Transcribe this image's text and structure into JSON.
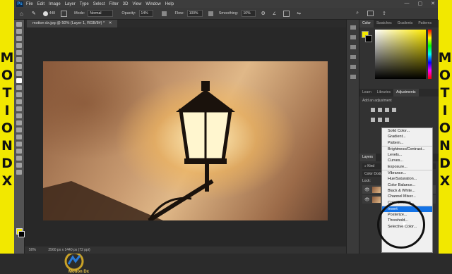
{
  "brand": {
    "letters": [
      "M",
      "O",
      "T",
      "I",
      "O",
      "N",
      "D",
      "X"
    ]
  },
  "menubar": {
    "logo": "Ps",
    "items": [
      "File",
      "Edit",
      "Image",
      "Layer",
      "Type",
      "Select",
      "Filter",
      "3D",
      "View",
      "Window",
      "Help"
    ]
  },
  "options": {
    "mode_label": "Mode:",
    "mode_value": "Normal",
    "opacity_label": "Opacity:",
    "opacity_value": "14%",
    "flow_label": "Flow:",
    "flow_value": "100%",
    "smoothing_label": "Smoothing:",
    "smoothing_value": "10%",
    "brush_size": "448"
  },
  "document": {
    "tab_title": "motion dx.jpg @ 50% (Layer 1, RGB/8#) *",
    "zoom": "50%",
    "status": "2560 px x 1440 px (72 ppi)"
  },
  "panels": {
    "color_tabs": [
      "Color",
      "Swatches",
      "Gradients",
      "Patterns"
    ],
    "adj_tabs": [
      "Learn",
      "Libraries",
      "Adjustments"
    ],
    "adj_hint": "Add an adjustment",
    "layers_tab": "Layers",
    "layers_kind": "Kind",
    "lock_label": "Lock:",
    "color_def_label": "Color Dodge"
  },
  "adjustment_menu": {
    "groups": [
      [
        "Solid Color...",
        "Gradient...",
        "Pattern..."
      ],
      [
        "Brightness/Contrast...",
        "Levels...",
        "Curves...",
        "Exposure..."
      ],
      [
        "Vibrance...",
        "Hue/Saturation...",
        "Color Balance...",
        "Black & White...",
        "Channel Mixer...",
        "Color Lookup..."
      ],
      [
        "Invert",
        "Posterize...",
        "Threshold...",
        "Selective Color..."
      ]
    ],
    "selected": "Invert"
  },
  "watermark": {
    "text": "Motion Dx"
  },
  "colors": {
    "brand": "#f2e800",
    "accent": "#1473e6"
  }
}
